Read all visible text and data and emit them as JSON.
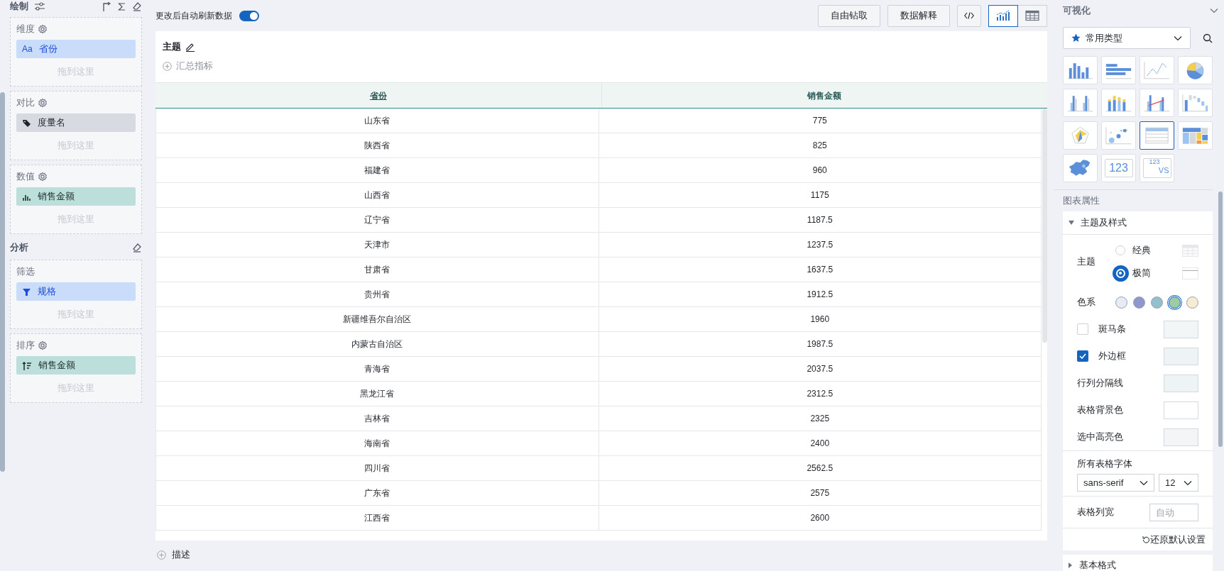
{
  "left_panel": {
    "title": "绘制",
    "groups": [
      {
        "label": "维度",
        "settings": true,
        "field": {
          "kind": "dimension",
          "type_mark": "Aa",
          "label": "省份"
        },
        "hint": "拖到这里"
      },
      {
        "label": "对比",
        "settings": true,
        "field": {
          "kind": "tag",
          "label": "度量名"
        },
        "hint": "拖到这里"
      },
      {
        "label": "数值",
        "settings": true,
        "field": {
          "kind": "measure",
          "label": "销售金额"
        },
        "hint": "拖到这里"
      }
    ],
    "analysis_title": "分析",
    "analysis_groups": [
      {
        "label": "筛选",
        "settings": false,
        "field": {
          "kind": "filter",
          "label": "规格"
        },
        "hint": "拖到这里"
      },
      {
        "label": "排序",
        "settings": true,
        "field": {
          "kind": "sort",
          "label": "销售金额"
        },
        "hint": "拖到这里"
      }
    ]
  },
  "toolbar": {
    "auto_refresh_label": "更改后自动刷新数据",
    "auto_refresh_on": true,
    "buttons": [
      "自由钻取",
      "数据解释"
    ],
    "views": [
      {
        "kind": "chart",
        "selected": true
      },
      {
        "kind": "table",
        "selected": false
      }
    ]
  },
  "card": {
    "title": "主题",
    "add_metric": "汇总指标",
    "table": {
      "columns": [
        "省份",
        "销售金额"
      ],
      "rows": [
        [
          "山东省",
          "775"
        ],
        [
          "陕西省",
          "825"
        ],
        [
          "福建省",
          "960"
        ],
        [
          "山西省",
          "1175"
        ],
        [
          "辽宁省",
          "1187.5"
        ],
        [
          "天津市",
          "1237.5"
        ],
        [
          "甘肃省",
          "1637.5"
        ],
        [
          "贵州省",
          "1912.5"
        ],
        [
          "新疆维吾尔自治区",
          "1960"
        ],
        [
          "内蒙古自治区",
          "1987.5"
        ],
        [
          "青海省",
          "2037.5"
        ],
        [
          "黑龙江省",
          "2312.5"
        ],
        [
          "吉林省",
          "2325"
        ],
        [
          "海南省",
          "2400"
        ],
        [
          "四川省",
          "2562.5"
        ],
        [
          "广东省",
          "2575"
        ],
        [
          "江西省",
          "2600"
        ]
      ]
    }
  },
  "add_description": "描述",
  "right_panel": {
    "title": "可视化",
    "type_filter": "常用类型",
    "chart_types": [
      {
        "kind": "column",
        "selected": false
      },
      {
        "kind": "bar",
        "selected": false
      },
      {
        "kind": "line",
        "selected": false
      },
      {
        "kind": "pie",
        "selected": false
      },
      {
        "kind": "grouped",
        "selected": false
      },
      {
        "kind": "stacked",
        "selected": false
      },
      {
        "kind": "combo",
        "selected": false
      },
      {
        "kind": "waterfall",
        "selected": false
      },
      {
        "kind": "radar",
        "selected": false
      },
      {
        "kind": "scatter",
        "selected": false
      },
      {
        "kind": "table",
        "selected": true
      },
      {
        "kind": "treemap",
        "selected": false
      },
      {
        "kind": "map",
        "selected": false
      },
      {
        "kind": "kpi",
        "selected": false,
        "texts": [
          "123"
        ]
      },
      {
        "kind": "compare",
        "selected": false,
        "texts": [
          "123",
          "VS"
        ]
      }
    ],
    "properties_title": "图表属性",
    "section": {
      "title": "主题及样式",
      "expanded": true,
      "theme_label": "主题",
      "themes": [
        {
          "label": "经典",
          "kind": "classic",
          "selected": false
        },
        {
          "label": "极简",
          "kind": "minimal",
          "selected": true
        }
      ],
      "palette_label": "色系",
      "palettes": [
        {
          "color": "#e6ecf6",
          "selected": false
        },
        {
          "color": "#8f98cc",
          "selected": false
        },
        {
          "color": "#94bfcc",
          "selected": false
        },
        {
          "color": "#9ccba5",
          "selected": true
        },
        {
          "color": "#f6ecd3",
          "selected": false
        }
      ],
      "options": [
        {
          "kind": "checkbox",
          "label": "斑马条",
          "checked": false,
          "color": "#f2f6f6"
        },
        {
          "kind": "checkbox",
          "label": "外边框",
          "checked": true,
          "color": "#eef4f6"
        },
        {
          "kind": "plain",
          "label": "行列分隔线",
          "color": "#eef4f6"
        },
        {
          "kind": "plain",
          "label": "表格背景色",
          "color": "#ffffff"
        },
        {
          "kind": "plain",
          "label": "选中高亮色",
          "color": "#f4f5f7"
        }
      ],
      "font_label": "所有表格字体",
      "font_family": "sans-serif",
      "font_size": "12",
      "width_label": "表格列宽",
      "width_placeholder": "自动",
      "reset": "还原默认设置"
    },
    "collapsed_section": {
      "title": "基本格式",
      "expanded": false
    }
  }
}
